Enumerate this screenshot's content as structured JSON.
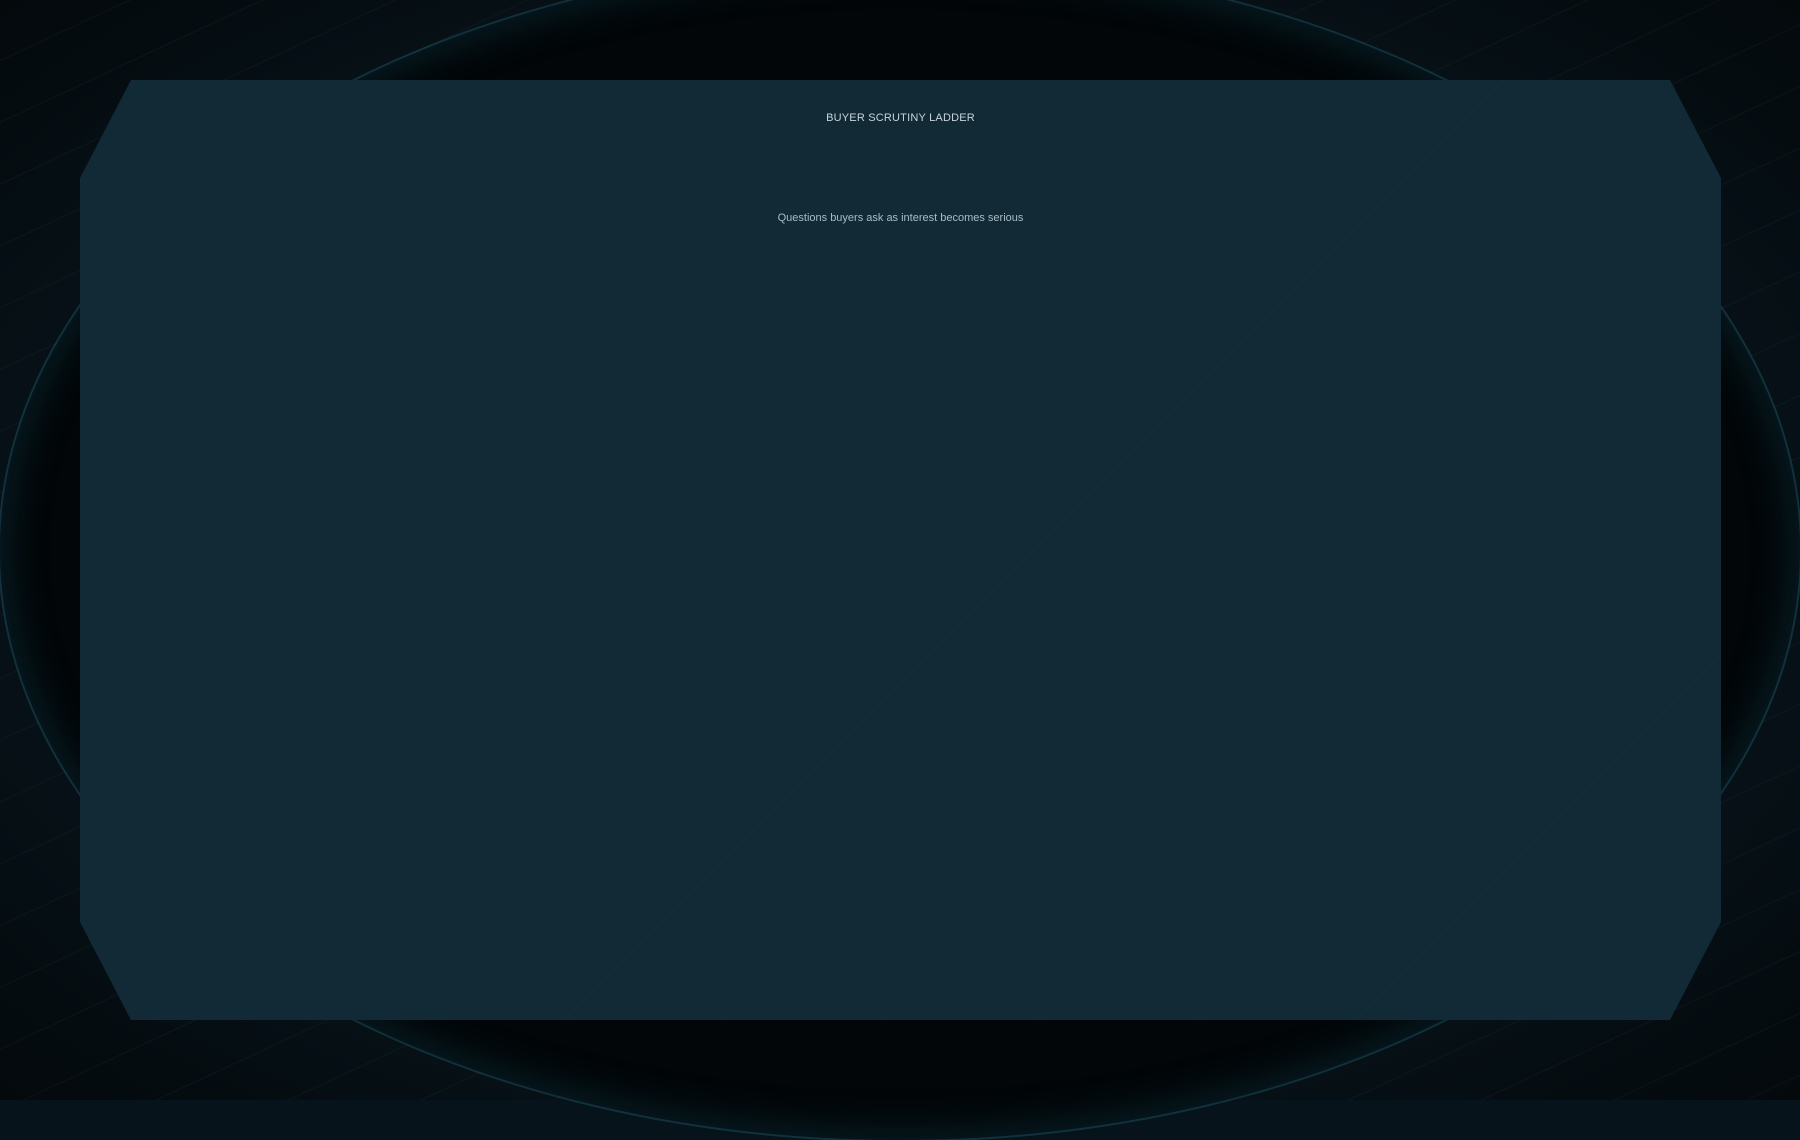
{
  "header": {
    "title": "BUYER SCRUTINY LADDER",
    "subtitle": "Questions buyers ask as interest becomes serious"
  },
  "colors": {
    "panel_background": "#122a36",
    "page_background": "#06131a",
    "title_text": "#c7d4da",
    "subtitle_text": "#a9bcc4"
  }
}
